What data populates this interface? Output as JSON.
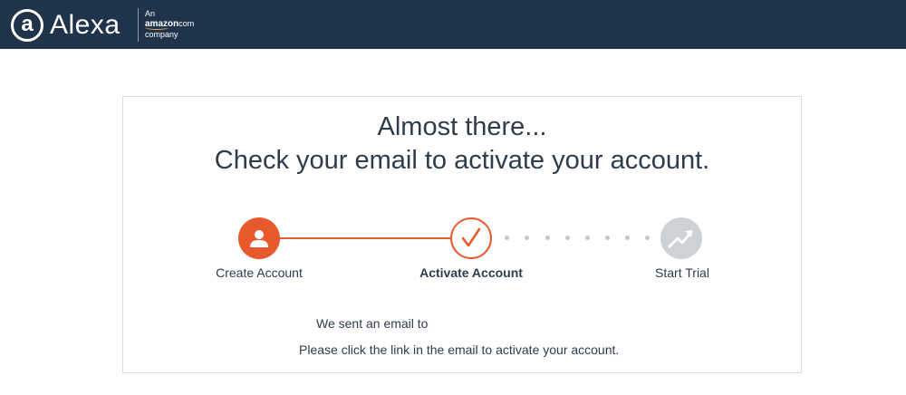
{
  "header": {
    "logo_glyph": "a",
    "logo_text": "Alexa",
    "tagline_line1": "An",
    "tagline_brand": "amazon",
    "tagline_brand_suffix": "com",
    "tagline_line3": "company"
  },
  "main": {
    "title_line1": "Almost there...",
    "title_line2": "Check your email to activate your account."
  },
  "steps": [
    {
      "label": "Create Account",
      "status": "complete",
      "icon": "person-icon"
    },
    {
      "label": "Activate Account",
      "status": "current",
      "icon": "checkmark-icon"
    },
    {
      "label": "Start Trial",
      "status": "pending",
      "icon": "trend-up-icon"
    }
  ],
  "message": {
    "sent_line": "We sent an email to",
    "instruction_line": "Please click the link in the email to activate your account."
  },
  "colors": {
    "header_bg": "#1f344b",
    "accent": "#e85a2c",
    "pending": "#cfd2d4",
    "text": "#2e3c4c"
  }
}
